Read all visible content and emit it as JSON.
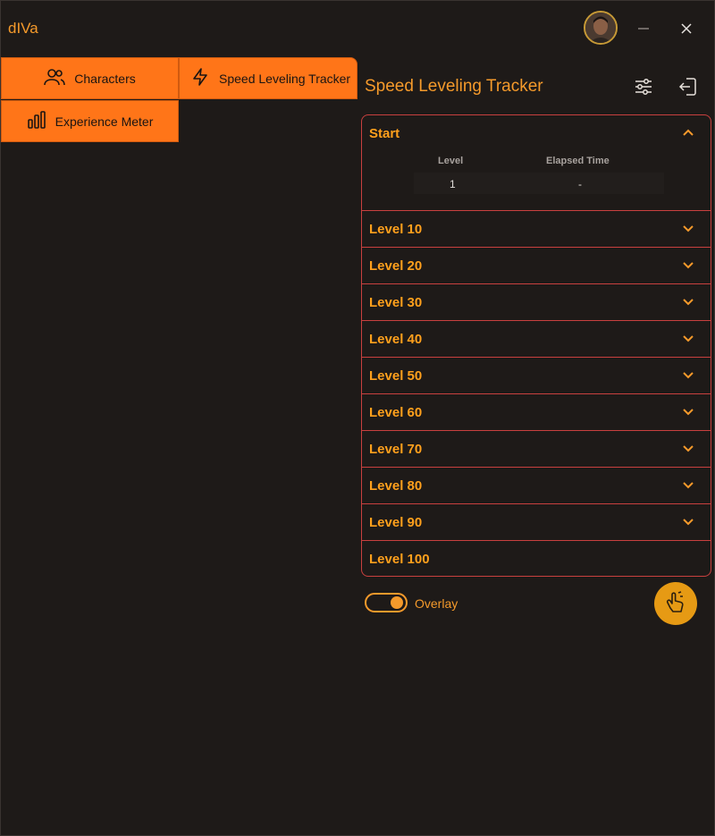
{
  "app": {
    "title": "dIVa"
  },
  "window": {
    "minimize_icon": "minimize-icon",
    "close_icon": "close-icon"
  },
  "nav": {
    "characters": {
      "label": "Characters",
      "icon": "people-icon"
    },
    "speed_tracker": {
      "label": "Speed Leveling Tracker",
      "icon": "lightning-icon"
    },
    "experience": {
      "label": "Experience Meter",
      "icon": "bar-chart-icon"
    }
  },
  "panel": {
    "title": "Speed Leveling Tracker",
    "settings_icon": "sliders-icon",
    "logout_icon": "logout-icon"
  },
  "accordion": {
    "start": {
      "label": "Start",
      "columns": [
        "Level",
        "Elapsed Time"
      ],
      "row": [
        "1",
        "-"
      ]
    },
    "levels": [
      "Level 10",
      "Level 20",
      "Level 30",
      "Level 40",
      "Level 50",
      "Level 60",
      "Level 70",
      "Level 80",
      "Level 90",
      "Level 100"
    ]
  },
  "overlay": {
    "label": "Overlay",
    "enabled": true
  },
  "colors": {
    "accent": "#ff7518",
    "text_accent": "#f59a2b",
    "border": "#c9403f",
    "background": "#1e1a18"
  }
}
